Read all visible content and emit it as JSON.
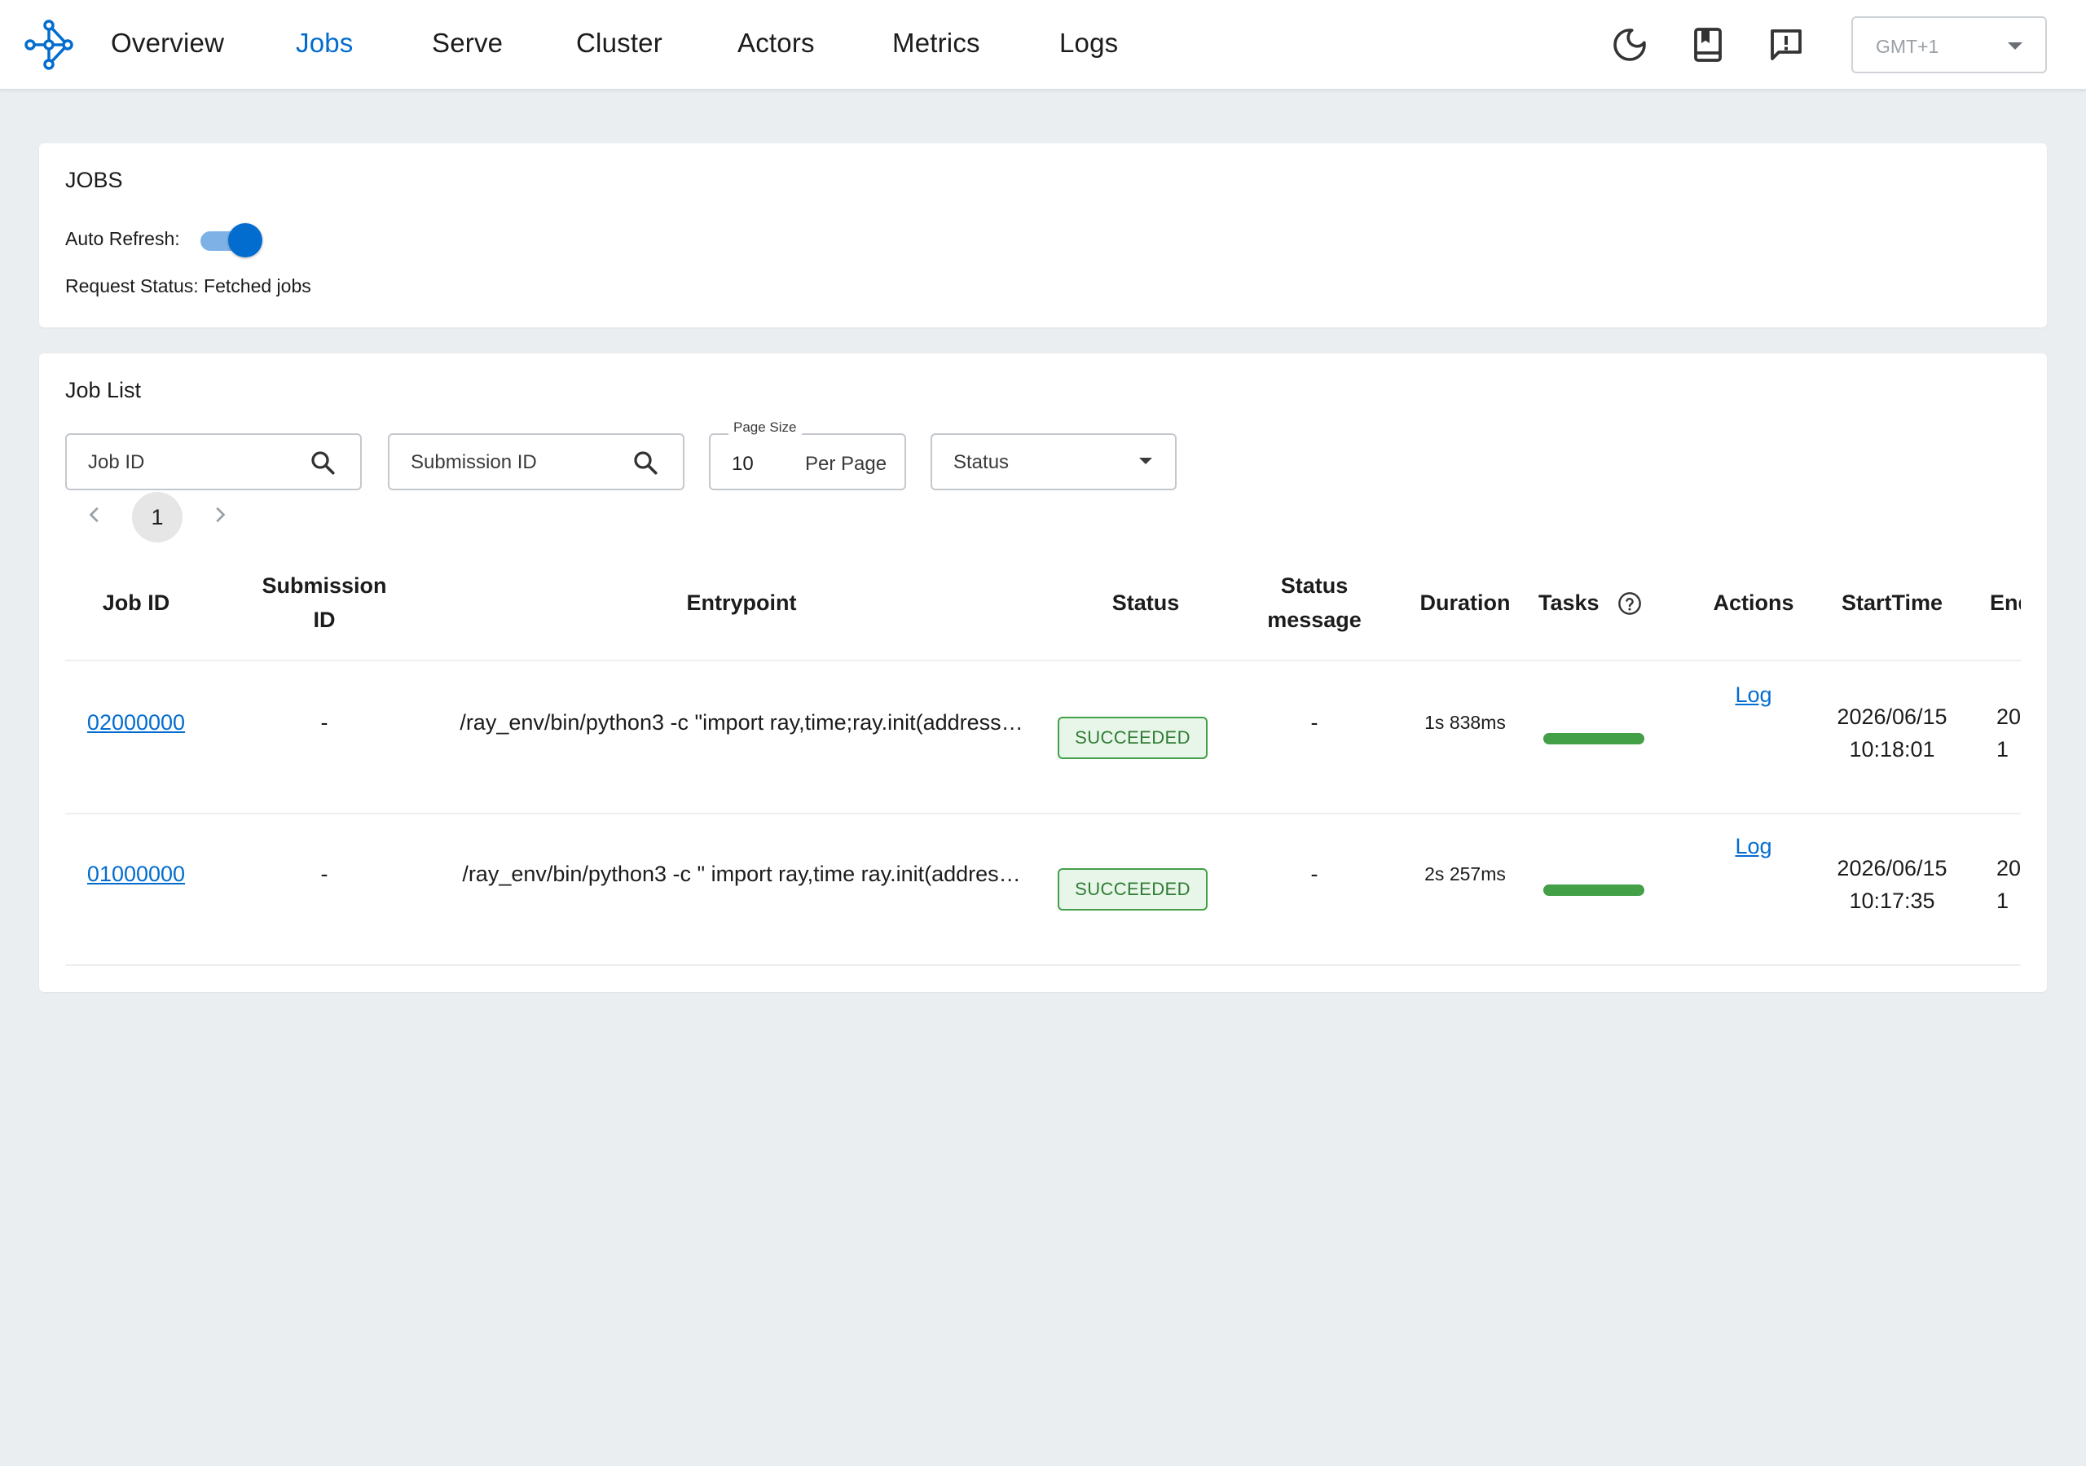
{
  "colors": {
    "accent": "#036dcf",
    "success": "#43a047",
    "page_bg": "#ebeef1"
  },
  "nav": {
    "items": [
      {
        "label": "Overview"
      },
      {
        "label": "Jobs",
        "active": true
      },
      {
        "label": "Serve"
      },
      {
        "label": "Cluster"
      },
      {
        "label": "Actors"
      },
      {
        "label": "Metrics"
      },
      {
        "label": "Logs"
      }
    ],
    "icons": [
      "moon-icon",
      "book-icon",
      "feedback-icon"
    ],
    "timezone": "GMT+1"
  },
  "jobs_card": {
    "title": "JOBS",
    "auto_refresh_label": "Auto Refresh:",
    "auto_refresh_on": true,
    "request_status": "Request Status: Fetched jobs"
  },
  "job_list": {
    "title": "Job List",
    "filters": {
      "job_id_placeholder": "Job ID",
      "submission_id_placeholder": "Submission ID",
      "page_size_label": "Page Size",
      "page_size_value": "10",
      "per_page_label": "Per Page",
      "status_placeholder": "Status"
    },
    "pagination": {
      "current": "1"
    },
    "columns": [
      "Job ID",
      "Submission ID",
      "Entrypoint",
      "Status",
      "Status message",
      "Duration",
      "Tasks",
      "Actions",
      "StartTime",
      "EndTime"
    ],
    "rows": [
      {
        "job_id": "02000000",
        "submission_id": "-",
        "entrypoint": "/ray_env/bin/python3 -c \"import ray,time;ray.init(address…",
        "status": "SUCCEEDED",
        "status_message": "-",
        "duration": "1s 838ms",
        "tasks_progress": 1.0,
        "action": "Log",
        "start_date": "2026/06/15",
        "start_time": "10:18:01",
        "end_date": "20",
        "end_time": "1"
      },
      {
        "job_id": "01000000",
        "submission_id": "-",
        "entrypoint": "/ray_env/bin/python3 -c \" import ray,time ray.init(addres…",
        "status": "SUCCEEDED",
        "status_message": "-",
        "duration": "2s 257ms",
        "tasks_progress": 1.0,
        "action": "Log",
        "start_date": "2026/06/15",
        "start_time": "10:17:35",
        "end_date": "20",
        "end_time": "1"
      }
    ]
  }
}
